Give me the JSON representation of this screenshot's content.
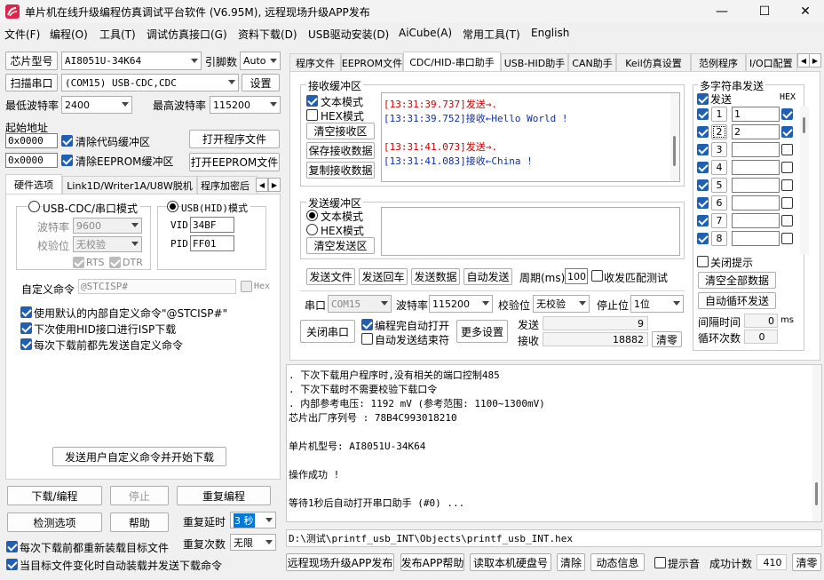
{
  "window": {
    "title": "单片机在线升级编程仿真调试平台软件 (V6.95M), 远程现场升级APP发布",
    "minimize": "—",
    "maximize": "☐",
    "close": "✕"
  },
  "menu": [
    "文件(F)",
    "编程(O)",
    "工具(T)",
    "调试仿真接口(G)",
    "资料下载(D)",
    "USB驱动安装(D)",
    "AiCube(A)",
    "常用工具(T)",
    "English"
  ],
  "left": {
    "chip_type_btn": "芯片型号",
    "chip_type": "AI8051U-34K64",
    "pin_count_label": "引脚数",
    "pin_count": "Auto",
    "scan_port_btn": "扫描串口",
    "port": "(COM15) USB-CDC,CDC",
    "settings_btn": "设置",
    "min_baud_label": "最低波特率",
    "min_baud": "2400",
    "max_baud_label": "最高波特率",
    "max_baud": "115200",
    "start_addr_label": "起始地址",
    "addr1": "0x0000",
    "clear_code_label": "清除代码缓冲区",
    "open_prog_btn": "打开程序文件",
    "addr2": "0x0000",
    "clear_eeprom_label": "清除EEPROM缓冲区",
    "open_eeprom_btn": "打开EEPROM文件",
    "tabs": [
      "硬件选项",
      "Link1D/Writer1A/U8W脱机",
      "程序加密后"
    ],
    "cdc_mode": "USB-CDC/串口模式",
    "hid_mode": "USB(HID)模式",
    "baud_label": "波特率",
    "baud": "9600",
    "parity_label": "校验位",
    "parity": "无校验",
    "rts": "RTS",
    "dtr": "DTR",
    "vid_label": "VID",
    "vid": "34BF",
    "pid_label": "PID",
    "pid": "FF01",
    "custom_cmd_label": "自定义命令",
    "custom_cmd": "@STCISP#",
    "hex_label": "Hex",
    "opt1": "使用默认的内部自定义命令\"@STCISP#\"",
    "opt2": "下次使用HID接口进行ISP下载",
    "opt3": "每次下载前都先发送自定义命令",
    "send_custom_btn": "发送用户自定义命令并开始下载",
    "download_btn": "下载/编程",
    "stop_btn": "停止",
    "reprogram_btn": "重复编程",
    "detect_btn": "检测选项",
    "help_btn": "帮助",
    "repeat_delay_label": "重复延时",
    "repeat_delay": "3 秒",
    "repeat_count_label": "重复次数",
    "repeat_count": "无限",
    "reload_label": "每次下载前都重新装载目标文件",
    "auto_load_label": "当目标文件变化时自动装载并发送下载命令"
  },
  "right": {
    "tabs": [
      "程序文件",
      "EEPROM文件",
      "CDC/HID-串口助手",
      "USB-HID助手",
      "CAN助手",
      "Keil仿真设置",
      "范例程序",
      "I/O口配置"
    ],
    "recv_title": "接收缓冲区",
    "text_mode": "文本模式",
    "hex_mode": "HEX模式",
    "clear_recv": "清空接收区",
    "save_recv": "保存接收数据",
    "copy_recv": "复制接收数据",
    "recv_lines": [
      {
        "ts": "[13:31:39.737]",
        "dir": "发送→",
        "msg": ".",
        "type": "send"
      },
      {
        "ts": "[13:31:39.752]",
        "dir": "接收←",
        "msg": "Hello World !",
        "type": "recv"
      },
      {
        "ts": "[13:31:41.073]",
        "dir": "发送→",
        "msg": ".",
        "type": "send"
      },
      {
        "ts": "[13:31:41.083]",
        "dir": "接收←",
        "msg": "China !",
        "type": "recv"
      }
    ],
    "send_title": "发送缓冲区",
    "send_text_mode": "文本模式",
    "send_hex_mode": "HEX模式",
    "clear_send": "清空发送区",
    "send_file_btn": "发送文件",
    "send_return_btn": "发送回车",
    "send_data_btn": "发送数据",
    "auto_send_btn": "自动发送",
    "period_label": "周期(ms)",
    "period": "100",
    "close_match_label": "收发匹配测试",
    "port_label": "串口",
    "port": "COM15",
    "baud_label": "波特率",
    "baud": "115200",
    "parity_label": "校验位",
    "parity": "无校验",
    "stop_label": "停止位",
    "stop": "1位",
    "close_port_btn": "关闭串口",
    "auto_open_label": "编程完自动打开",
    "auto_send_end_label": "自动发送结束符",
    "more_settings_btn": "更多设置",
    "sent_label": "发送",
    "sent": "9",
    "recv_label": "接收",
    "recv": "18882",
    "clear_count_btn": "清零",
    "multi_title": "多字符串发送",
    "multi_send_label": "发送",
    "multi_hex_label": "HEX",
    "multi_rows": [
      {
        "n": "1",
        "v": "1",
        "on": true,
        "hex": true
      },
      {
        "n": "2",
        "v": "2",
        "on": true,
        "hex": true
      },
      {
        "n": "3",
        "v": "",
        "on": true,
        "hex": false
      },
      {
        "n": "4",
        "v": "",
        "on": true,
        "hex": false
      },
      {
        "n": "5",
        "v": "",
        "on": true,
        "hex": false
      },
      {
        "n": "6",
        "v": "",
        "on": true,
        "hex": false
      },
      {
        "n": "7",
        "v": "",
        "on": true,
        "hex": false
      },
      {
        "n": "8",
        "v": "",
        "on": true,
        "hex": false
      }
    ],
    "close_hint_label": "关闭提示",
    "clear_all_btn": "清空全部数据",
    "auto_loop_btn": "自动循环发送",
    "interval_label": "间隔时间",
    "interval": "0",
    "interval_unit": "ms",
    "loop_label": "循环次数",
    "loop": "0"
  },
  "log": {
    "lines": [
      ". 下次下载用户程序时,没有相关的端口控制485",
      ". 下次下载时不需要校验下载口令",
      ". 内部参考电压: 1192 mV (参考范围: 1100~1300mV)",
      "芯片出厂序列号 : 78B4C993018210",
      "",
      "单片机型号: AI8051U-34K64",
      "",
      "操作成功 !",
      "",
      "等待1秒后自动打开串口助手 (#0) ..."
    ],
    "path": "D:\\测试\\printf_usb_INT\\Objects\\printf_usb_INT.hex"
  },
  "bottom": {
    "remote_btn": "远程现场升级APP发布",
    "publish_help_btn": "发布APP帮助",
    "read_disk_btn": "读取本机硬盘号",
    "clear_btn": "清除",
    "anim_btn": "动态信息",
    "beep_label": "提示音",
    "success_label": "成功计数",
    "success": "410",
    "clear2_btn": "清零"
  }
}
